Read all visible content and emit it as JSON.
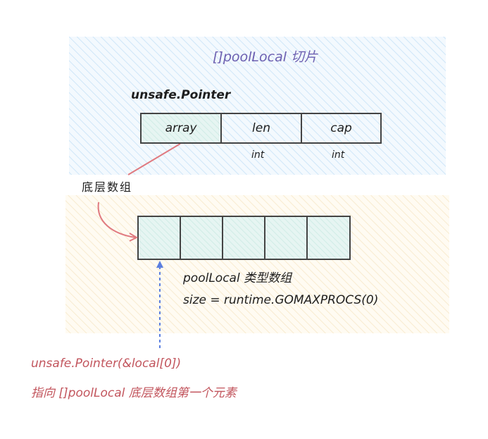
{
  "slice": {
    "title": "[]poolLocal 切片",
    "header_label": "unsafe.Pointer",
    "fields": [
      {
        "name": "array",
        "type": ""
      },
      {
        "name": "len",
        "type": "int"
      },
      {
        "name": "cap",
        "type": "int"
      }
    ]
  },
  "underlying_label": "底层数组",
  "array": {
    "cell_count": 5,
    "type_label": "poolLocal 类型数组",
    "size_label": "size = runtime.GOMAXPROCS(0)"
  },
  "pointer_note": {
    "line1": "unsafe.Pointer(&local[0])",
    "line2": "指向 []poolLocal 底层数组第一个元素"
  },
  "colors": {
    "slice_region": "#a5d8ff",
    "array_region": "#ffec99",
    "title": "#6c5fb0",
    "red": "#c2555d",
    "arrow_red": "#e07a80",
    "arrow_blue": "#5b7fe0",
    "cell_fill": "#e3f4f1"
  }
}
